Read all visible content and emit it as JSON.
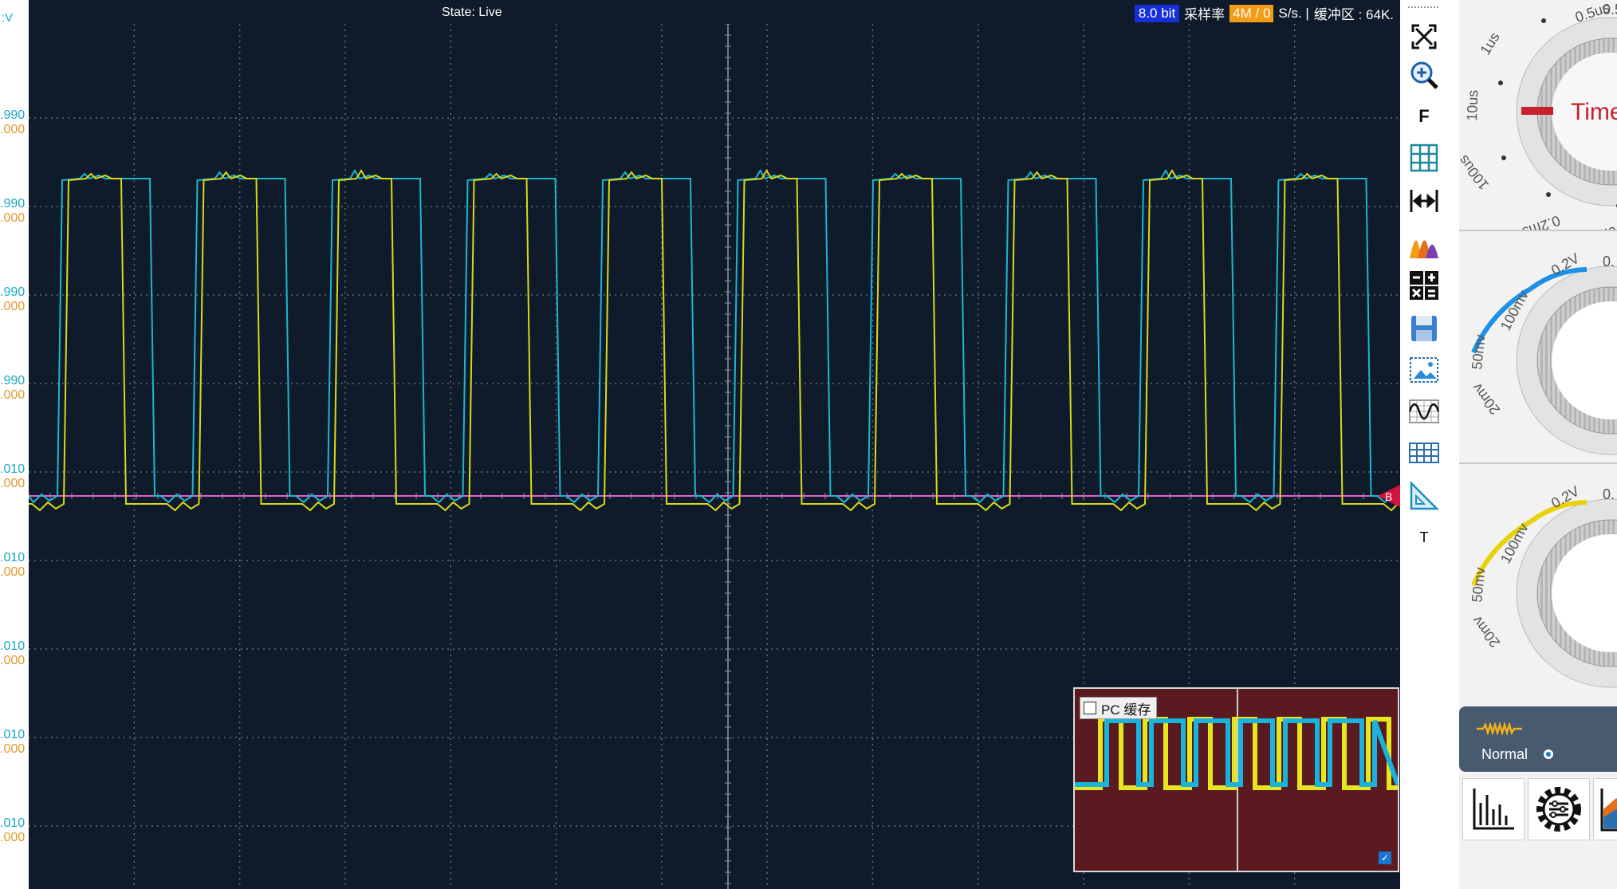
{
  "header": {
    "state": "State: Live",
    "bit_depth": "8.0 bit",
    "sample_rate_label": "采样率",
    "sample_rate_value": "4M / 0",
    "sample_rate_unit": "S/s. |",
    "buffer_label": "缓冲区 : 64K."
  },
  "axis": {
    "unit_label": ":V",
    "labels": [
      {
        "ch1": ".990",
        "ch2": ".000"
      },
      {
        "ch1": ".990",
        "ch2": ".000"
      },
      {
        "ch1": ".990",
        "ch2": ".000"
      },
      {
        "ch1": ".990",
        "ch2": ".000"
      },
      {
        "ch1": ".010",
        "ch2": ".000"
      },
      {
        "ch1": ".010",
        "ch2": ".000"
      },
      {
        "ch1": ".010",
        "ch2": ".000"
      },
      {
        "ch1": ".010",
        "ch2": ".000"
      },
      {
        "ch1": ".010",
        "ch2": ".000"
      }
    ]
  },
  "trace": {
    "trigger_marker": "B",
    "ch1_color": "#1cb6cf",
    "ch2_color": "#d8d81a",
    "baseline_color": "#e060d0",
    "grid_color": "#5f6e80"
  },
  "overview": {
    "pc_cache_label": "PC 缓存",
    "pc_cache_checked": false,
    "auto_checked": true
  },
  "toolbar": {
    "items": [
      {
        "icon": "fit-screen-icon"
      },
      {
        "icon": "zoom-in-icon"
      },
      {
        "icon": "fft-text-icon",
        "text": "F"
      },
      {
        "icon": "grid-icon"
      },
      {
        "icon": "measure-horizontal-icon"
      },
      {
        "icon": "spectrum-icon"
      },
      {
        "icon": "math-icon"
      },
      {
        "icon": "save-icon"
      },
      {
        "icon": "screenshot-icon"
      },
      {
        "icon": "waveform-icon"
      },
      {
        "icon": "table-icon"
      },
      {
        "icon": "ruler-icon"
      },
      {
        "icon": "text-icon",
        "text": "T"
      }
    ]
  },
  "knobs": {
    "timebase": {
      "labels": [
        "0.5us",
        "1us",
        "10us",
        "100us",
        "0.2ms",
        "0.5ms",
        "0.5"
      ],
      "dial_text": "Time"
    },
    "ch1": {
      "labels": [
        "0.2V",
        "100mv",
        "50mv",
        "20mv",
        "0."
      ],
      "accent": "#1e90e6"
    },
    "ch2": {
      "labels": [
        "0.2V",
        "100mv",
        "50mv",
        "20mv",
        "0."
      ],
      "accent": "#e8d20a"
    }
  },
  "trigger": {
    "mode": "Normal"
  },
  "bottom_buttons": [
    {
      "icon": "histogram-icon"
    },
    {
      "icon": "settings-gear-icon"
    },
    {
      "icon": "area-chart-icon"
    }
  ]
}
